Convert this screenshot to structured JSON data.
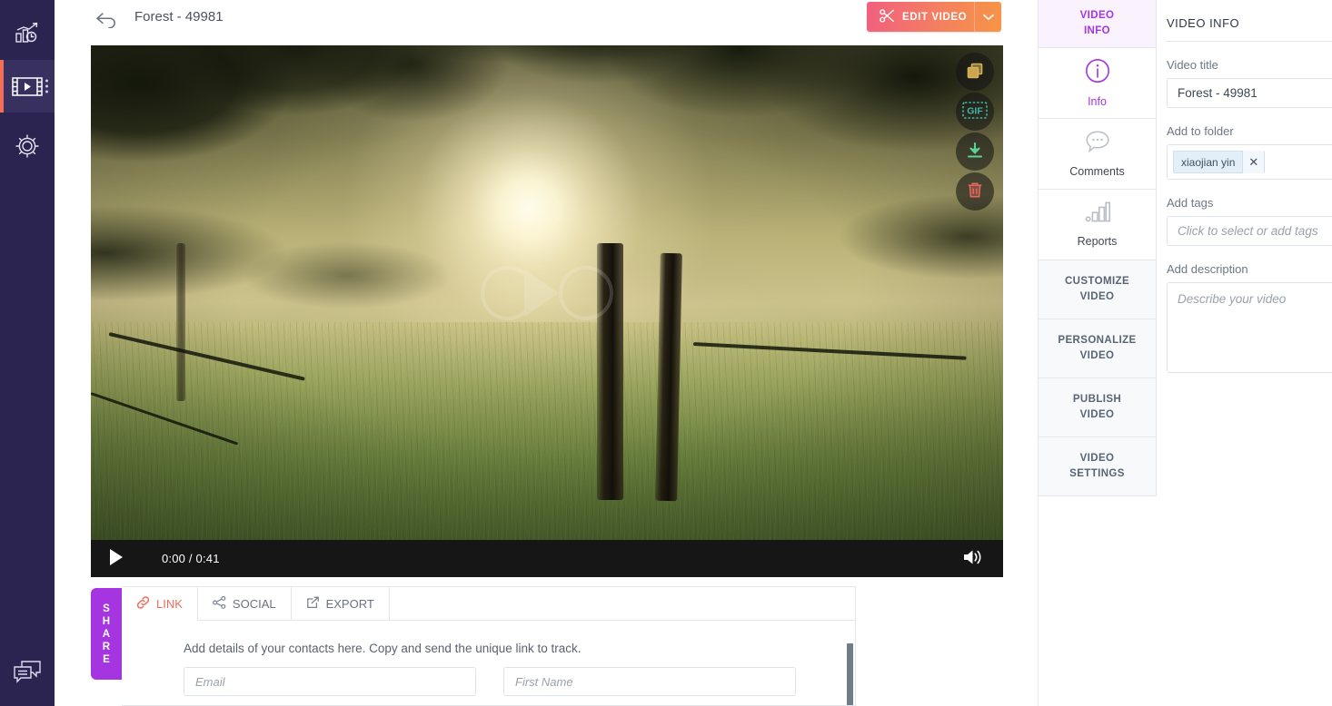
{
  "left_rail": {
    "items": [
      {
        "name": "analytics",
        "icon": "analytics-chart-icon",
        "active": false
      },
      {
        "name": "videos",
        "icon": "video-film-icon",
        "active": true,
        "has_kebab": true
      },
      {
        "name": "settings",
        "icon": "gear-icon",
        "active": false
      }
    ],
    "bottom": {
      "name": "chat",
      "icon": "chat-bubbles-icon"
    },
    "active_indicator_color": "#f2705a",
    "background_color": "#2b2350"
  },
  "topbar": {
    "back_icon": "back-arrow-icon",
    "title": "Forest - 49981",
    "edit_video": {
      "label": "EDIT VIDEO",
      "icon": "scissors-icon",
      "caret_icon": "chevron-down-icon",
      "gradient_from": "#f2607e",
      "gradient_to": "#f79447"
    }
  },
  "player": {
    "overlay_actions": [
      {
        "name": "copy",
        "icon": "copy-icon",
        "color": "#d5b35a"
      },
      {
        "name": "gif",
        "icon": "gif-icon",
        "color": "#3fb8a8",
        "text": "GIF"
      },
      {
        "name": "download",
        "icon": "download-icon",
        "color": "#5ad39b"
      },
      {
        "name": "delete",
        "icon": "trash-icon",
        "color": "#e8695e"
      }
    ],
    "controls": {
      "play_icon": "play-icon",
      "time": "0:00 / 0:41",
      "volume_icon": "volume-on-icon"
    }
  },
  "share": {
    "tab_letters": [
      "S",
      "H",
      "A",
      "R",
      "E"
    ],
    "tab_color": "#a435e0",
    "tabs": [
      {
        "label": "LINK",
        "icon": "link-icon",
        "active": true
      },
      {
        "label": "SOCIAL",
        "icon": "share-nodes-icon",
        "active": false
      },
      {
        "label": "EXPORT",
        "icon": "export-icon",
        "active": false
      }
    ],
    "hint": "Add details of your contacts here. Copy and send the unique link to track.",
    "email_placeholder": "Email",
    "firstname_placeholder": "First Name"
  },
  "right_tabs": [
    {
      "label": "VIDEO INFO",
      "type": "head",
      "lines": [
        "VIDEO",
        "INFO"
      ],
      "active": true
    },
    {
      "label": "Info",
      "type": "icon",
      "icon": "info-circle-icon",
      "active": true
    },
    {
      "label": "Comments",
      "type": "icon",
      "icon": "comment-bubble-icon",
      "active": false
    },
    {
      "label": "Reports",
      "type": "icon",
      "icon": "bar-chart-icon",
      "active": false
    },
    {
      "label": "CUSTOMIZE VIDEO",
      "type": "text",
      "lines": [
        "CUSTOMIZE",
        "VIDEO"
      ],
      "active": false
    },
    {
      "label": "PERSONALIZE VIDEO",
      "type": "text",
      "lines": [
        "PERSONALIZE",
        "VIDEO"
      ],
      "active": false
    },
    {
      "label": "PUBLISH VIDEO",
      "type": "text",
      "lines": [
        "PUBLISH",
        "VIDEO"
      ],
      "active": false
    },
    {
      "label": "VIDEO SETTINGS",
      "type": "text",
      "lines": [
        "VIDEO",
        "SETTINGS"
      ],
      "active": false
    }
  ],
  "info_pane": {
    "heading": "VIDEO INFO",
    "video_title_label": "Video title",
    "video_title_value": "Forest - 49981",
    "folder_label": "Add to folder",
    "folder_chip": "xiaojian yin",
    "folder_chip_remove_icon": "close-icon",
    "tags_label": "Add tags",
    "tags_placeholder": "Click to select or add tags",
    "description_label": "Add description",
    "description_placeholder": "Describe your video"
  },
  "accent_colors": {
    "purple": "#a435e0",
    "coral": "#ef6c5a",
    "navy": "#2b2350"
  }
}
